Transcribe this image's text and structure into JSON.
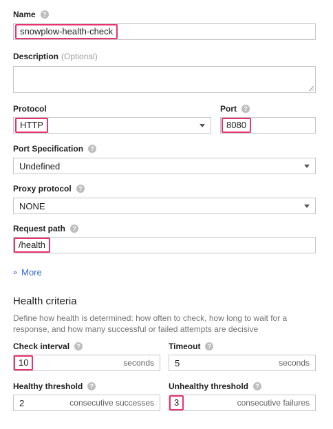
{
  "name": {
    "label": "Name",
    "value": "snowplow-health-check"
  },
  "description": {
    "label": "Description",
    "optional": "(Optional)",
    "value": ""
  },
  "protocol": {
    "label": "Protocol",
    "value": "HTTP"
  },
  "port": {
    "label": "Port",
    "value": "8080"
  },
  "port_spec": {
    "label": "Port Specification",
    "value": "Undefined"
  },
  "proxy": {
    "label": "Proxy protocol",
    "value": "NONE"
  },
  "request_path": {
    "label": "Request path",
    "value": "/health"
  },
  "more": {
    "label": "More"
  },
  "health": {
    "title": "Health criteria",
    "description": "Define how health is determined: how often to check, how long to wait for a response, and how many successful or failed attempts are decisive",
    "check_interval": {
      "label": "Check interval",
      "value": "10",
      "unit": "seconds"
    },
    "timeout": {
      "label": "Timeout",
      "value": "5",
      "unit": "seconds"
    },
    "healthy_threshold": {
      "label": "Healthy threshold",
      "value": "2",
      "unit": "consecutive successes"
    },
    "unhealthy_threshold": {
      "label": "Unhealthy threshold",
      "value": "3",
      "unit": "consecutive failures"
    }
  },
  "highlight_color": "#e8336f",
  "link_color": "#3367d6"
}
